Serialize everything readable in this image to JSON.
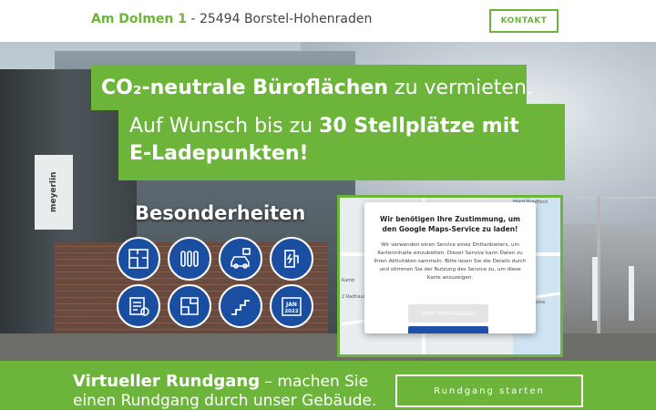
{
  "header": {
    "street": "Am Dolmen 1",
    "city": " - 25494 Borstel-Hohenraden",
    "contact_label": "KONTAKT"
  },
  "hero": {
    "sign_text": "meyerlin",
    "headline_bold": "CO₂-neutrale Büroflächen",
    "headline_rest": "zu vermieten.",
    "sub_pre": "Auf Wunsch bis zu ",
    "sub_bold1": "30 Stellplätze mit",
    "sub_bold2": "E-Ladepunkten!"
  },
  "features": {
    "title": "Besonderheiten",
    "calendar_month": "JAN",
    "calendar_year": "2022",
    "icons": [
      "floorplan-icon",
      "radiator-icon",
      "ev-charging-icon",
      "charging-station-icon",
      "meter-icon",
      "blueprint-icon",
      "stairs-icon",
      "calendar-icon"
    ]
  },
  "map": {
    "label_top": "Horst Bradfisch",
    "label_left": "Kamb",
    "label_bottom": "2 Radhaus S",
    "label_right": "ervice",
    "consent_title": "Wir benötigen Ihre Zustimmung, um den Google Maps-Service zu laden!",
    "consent_text": "Wir verwenden einen Service eines Drittanbieters, um Karteninhalte einzubetten. Dieser Service kann Daten zu Ihren Aktivitäten sammeln. Bitte lesen Sie die Details durch und stimmen Sie der Nutzung des Service zu, um diese Karte anzuzeigen.",
    "more_info_label": "Mehr Informationen"
  },
  "tour": {
    "bold": "Virtueller Rundgang",
    "rest": " – machen Sie einen Rundgang durch unser Gebäude.",
    "button_label": "Rundgang starten"
  },
  "colors": {
    "brand_green": "#6cb53a",
    "feature_blue": "#1a4ea0",
    "consent_blue": "#1f4fa8"
  }
}
